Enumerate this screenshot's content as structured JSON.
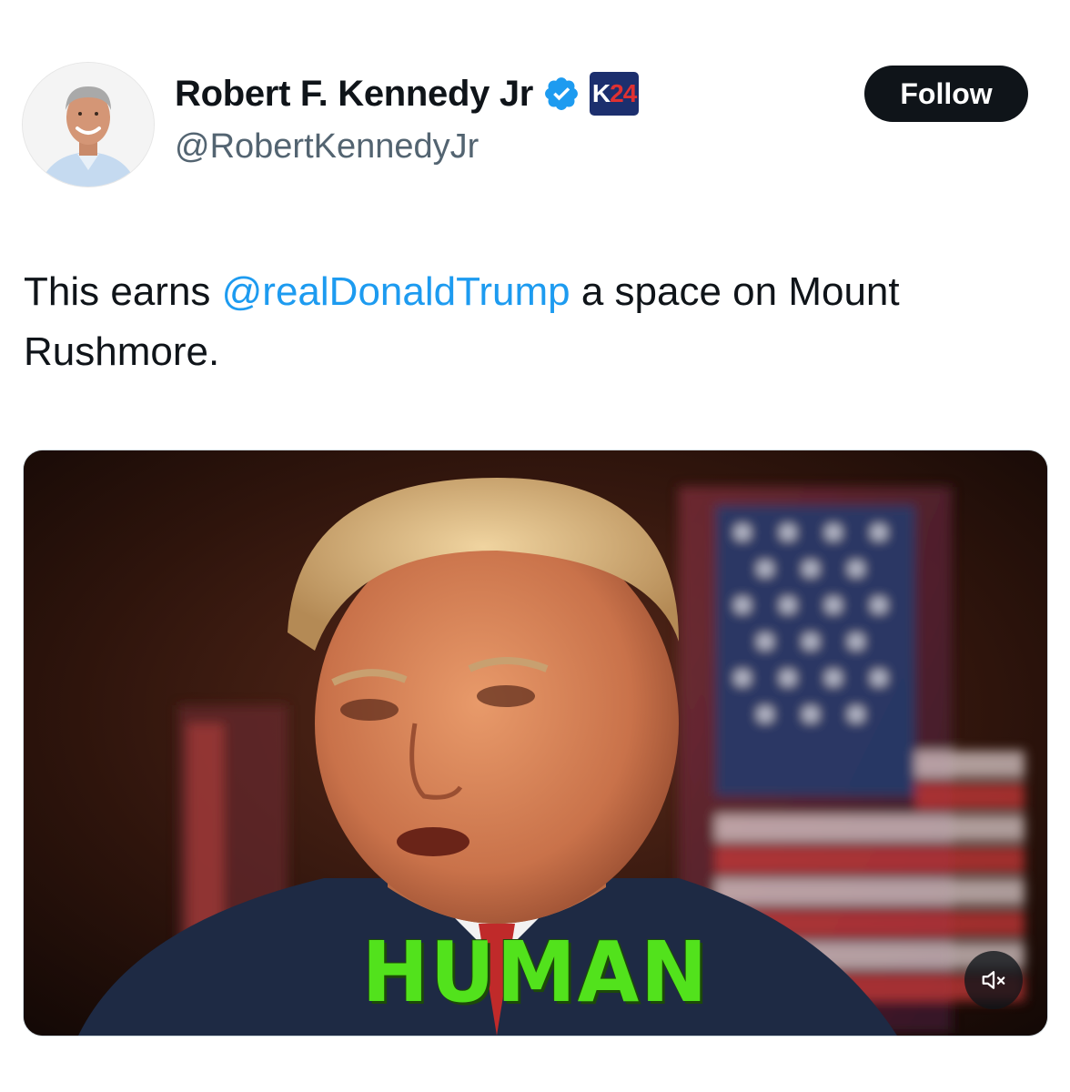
{
  "author": {
    "display_name": "Robert F. Kennedy Jr",
    "handle": "@RobertKennedyJr",
    "verified": true,
    "affiliate_badge": {
      "prefix": "K",
      "number": "24"
    }
  },
  "follow_button": {
    "label": "Follow"
  },
  "tweet": {
    "text_before": "This earns ",
    "mention": "@realDonaldTrump",
    "text_after": " a space on Mount Rushmore."
  },
  "media": {
    "caption": "HUMAN",
    "muted": true,
    "mute_icon": "speaker-muted-icon"
  },
  "colors": {
    "text": "#0f1419",
    "secondary": "#536471",
    "link": "#1d9bf0",
    "verified": "#1d9bf0",
    "button_bg": "#0f1419",
    "caption": "#52e21c"
  }
}
